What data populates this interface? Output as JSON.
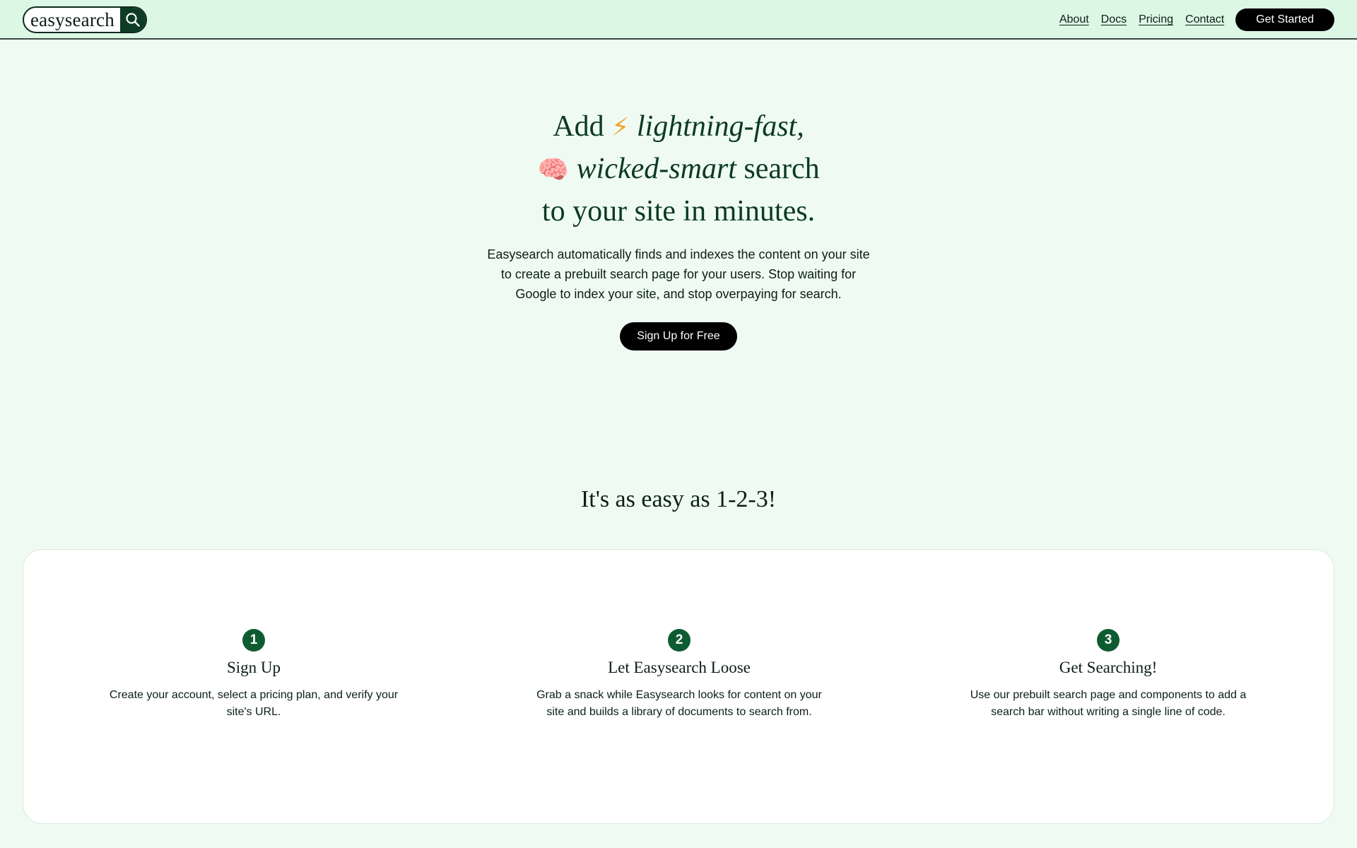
{
  "brand": {
    "name": "easysearch",
    "icon": "search-icon"
  },
  "nav": {
    "links": [
      "About",
      "Docs",
      "Pricing",
      "Contact"
    ],
    "cta": "Get Started"
  },
  "hero": {
    "line1_prefix": "Add",
    "line1_emoji": "⚡",
    "line1_em": "lightning-fast,",
    "line2_emoji": "🧠",
    "line2_em": "wicked-smart",
    "line2_suffix": "search",
    "line3": "to your site in minutes.",
    "description": "Easysearch automatically finds and indexes the content on your site to create a prebuilt search page for your users. Stop waiting for Google to index your site, and stop overpaying for search.",
    "button": "Sign Up for Free"
  },
  "steps_section": {
    "title": "It's as easy as 1-2-3!",
    "steps": [
      {
        "number": "1",
        "title": "Sign Up",
        "description": "Create your account, select a pricing plan, and verify your site's URL."
      },
      {
        "number": "2",
        "title": "Let Easysearch Loose",
        "description": "Grab a snack while Easysearch looks for content on your site and builds a library of documents to search from."
      },
      {
        "number": "3",
        "title": "Get Searching!",
        "description": "Use our prebuilt search page and components to add a search bar without writing a single line of code."
      }
    ]
  },
  "colors": {
    "page_background": "#effbf2",
    "header_background": "#dcf7e4",
    "heading_green": "#0c3a22",
    "accent_green": "#0e5b32",
    "button_black": "#000000"
  }
}
